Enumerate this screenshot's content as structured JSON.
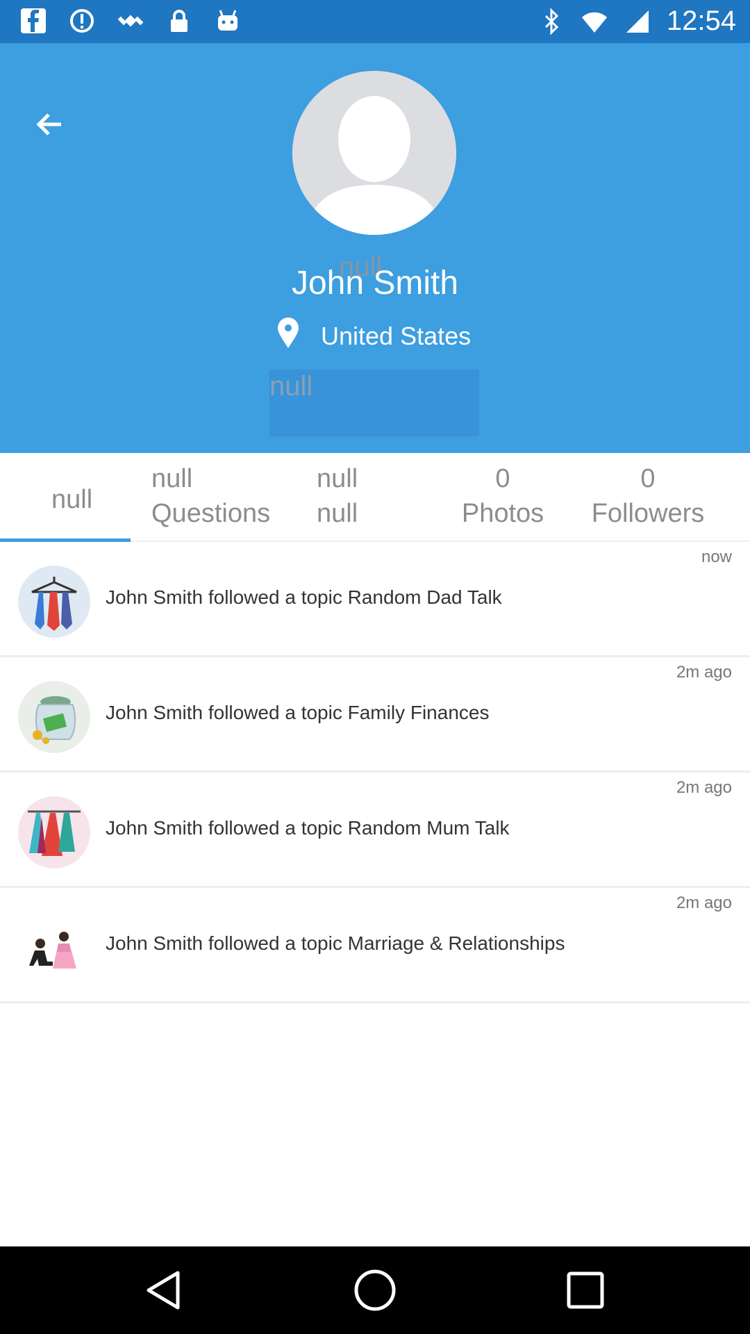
{
  "status_bar": {
    "time": "12:54",
    "left_icons": [
      "facebook-icon",
      "data-saver-icon",
      "fake-gps-icon",
      "lock-icon",
      "android-icon"
    ],
    "right_icons": [
      "bluetooth-icon",
      "wifi-icon",
      "signal-icon"
    ]
  },
  "profile": {
    "overlay_null": "null",
    "name": "John Smith",
    "location": "United States",
    "bio": "null",
    "colors": {
      "header": "#3d9ee0",
      "status_bar": "#1f76c1"
    }
  },
  "tabs": [
    {
      "line1": "null"
    },
    {
      "line1": "null",
      "line2": "Questions"
    },
    {
      "line1": "null",
      "line2": "null"
    },
    {
      "line1": "0",
      "line2": "Photos"
    },
    {
      "line1": "0",
      "line2": "Followers"
    }
  ],
  "activities": [
    {
      "time": "now",
      "text": "John Smith followed a topic Random Dad Talk",
      "icon": "ties-hanger-icon"
    },
    {
      "time": "2m ago",
      "text": "John Smith followed a topic Family Finances",
      "icon": "money-jar-icon"
    },
    {
      "time": "2m ago",
      "text": "John Smith followed a topic Random Mum Talk",
      "icon": "dresses-hanger-icon"
    },
    {
      "time": "2m ago",
      "text": "John Smith followed a topic Marriage & Relationships",
      "icon": "proposal-couple-icon"
    }
  ]
}
